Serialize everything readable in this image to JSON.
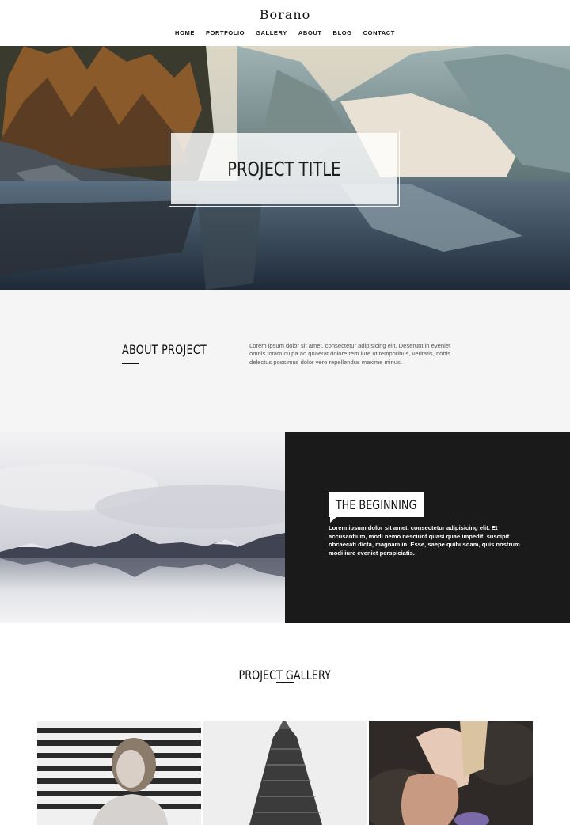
{
  "header": {
    "brand": "Borano",
    "nav": [
      "HOME",
      "PORTFOLIO",
      "GALLERY",
      "ABOUT",
      "BLOG",
      "CONTACT"
    ]
  },
  "hero": {
    "title": "PROJECT TITLE"
  },
  "about": {
    "title": "ABOUT PROJECT",
    "text": "Lorem ipsum dolor sit amet, consectetur adipisicing elit. Deserunt in eveniet omnis totam culpa ad quaerat dolore rem iure ut temporibus, veritatis, nobis delectus possimus dolor vero repellendus maxime minus."
  },
  "beginning": {
    "title": "THE BEGINNING",
    "text": "Lorem ipsum dolor sit amet, consectetur adipisicing elit. Et accusantium, modi nemo nesciunt quasi quae impedit, suscipit obcaecati dicta, magnam in. Esse, saepe quibusdam, quis nostrum modi iure eveniet perspiciatis."
  },
  "gallery": {
    "title": "PROJECT GALLERY"
  },
  "colors": {
    "dark_panel": "#1a1a1a",
    "light_section": "#f5f5f5",
    "text_dark": "#111111",
    "text_gray": "#555555"
  }
}
